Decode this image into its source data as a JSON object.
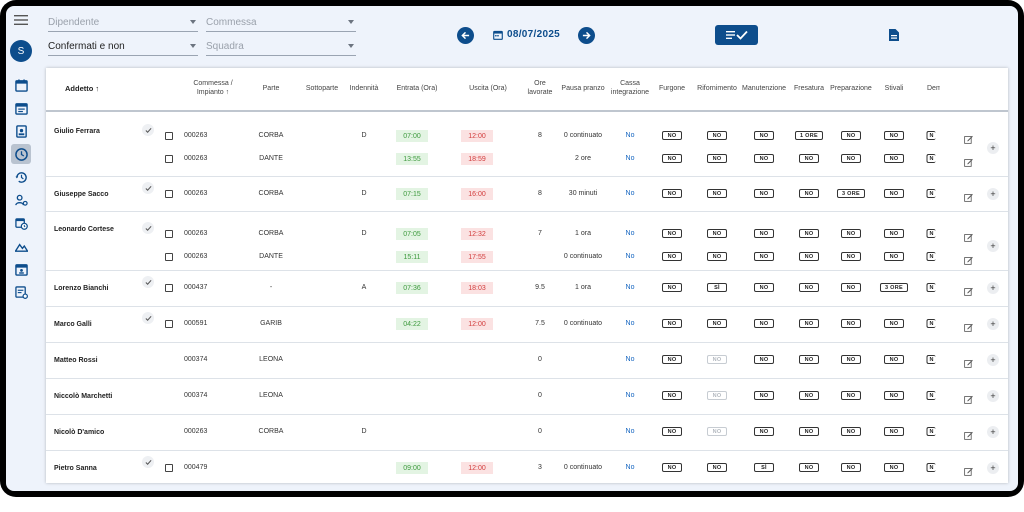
{
  "avatar_initial": "S",
  "filters": {
    "dipendente_placeholder": "Dipendente",
    "commessa_placeholder": "Commessa",
    "stato_value": "Confermati e non",
    "squadra_placeholder": "Squadra"
  },
  "date": "08/07/2025",
  "columns": {
    "addetto": "Addetto ↑",
    "commessa_l1": "Commessa /",
    "commessa_l2": "Impianto ↑",
    "parte": "Parte",
    "sottoparte": "Sottoparte",
    "indennita": "Indennità",
    "entrata": "Entrata (Ora)",
    "uscita": "Uscita (Ora)",
    "ore_l1": "Ore",
    "ore_l2": "lavorate",
    "pausa": "Pausa pranzo",
    "cassa_l1": "Cassa",
    "cassa_l2": "integrazione",
    "furgone": "Furgone",
    "rifornimento": "Rifornimento",
    "manutenzione": "Manutenzione",
    "fresatura": "Fresatura",
    "preparazione": "Preparazione",
    "stivali": "Stivali",
    "demo": "Demo"
  },
  "rows": [
    {
      "name": "Giulio Ferrara",
      "confirmed": true,
      "lines": [
        {
          "commessa": "000263",
          "parte": "CORBA",
          "indennita": "D",
          "entrata": "07:00",
          "uscita": "12:00",
          "ore": "8",
          "pausa": "0 continuato",
          "cassa": "No",
          "furgone": "NO",
          "rifornimento": "NO",
          "manutenzione": "NO",
          "fresatura": "1 ORE",
          "preparazione": "NO",
          "stivali": "NO",
          "demo": "N"
        },
        {
          "commessa": "000263",
          "parte": "DANTE",
          "indennita": "",
          "entrata": "13:55",
          "uscita": "18:59",
          "ore": "",
          "pausa": "2 ore",
          "cassa": "No",
          "furgone": "NO",
          "rifornimento": "NO",
          "manutenzione": "NO",
          "fresatura": "NO",
          "preparazione": "NO",
          "stivali": "NO",
          "demo": "N"
        }
      ]
    },
    {
      "name": "Giuseppe Sacco",
      "confirmed": true,
      "lines": [
        {
          "commessa": "000263",
          "parte": "CORBA",
          "indennita": "D",
          "entrata": "07:15",
          "uscita": "16:00",
          "ore": "8",
          "pausa": "30 minuti",
          "cassa": "No",
          "furgone": "NO",
          "rifornimento": "NO",
          "manutenzione": "NO",
          "fresatura": "NO",
          "preparazione": "3 ORE",
          "stivali": "NO",
          "demo": "N"
        }
      ]
    },
    {
      "name": "Leonardo Cortese",
      "confirmed": true,
      "lines": [
        {
          "commessa": "000263",
          "parte": "CORBA",
          "indennita": "D",
          "entrata": "07:05",
          "uscita": "12:32",
          "ore": "7",
          "pausa": "1 ora",
          "cassa": "No",
          "furgone": "NO",
          "rifornimento": "NO",
          "manutenzione": "NO",
          "fresatura": "NO",
          "preparazione": "NO",
          "stivali": "NO",
          "demo": "N"
        },
        {
          "commessa": "000263",
          "parte": "DANTE",
          "indennita": "",
          "entrata": "15:11",
          "uscita": "17:55",
          "ore": "",
          "pausa": "0 continuato",
          "cassa": "No",
          "furgone": "NO",
          "rifornimento": "NO",
          "manutenzione": "NO",
          "fresatura": "NO",
          "preparazione": "NO",
          "stivali": "NO",
          "demo": "N"
        }
      ]
    },
    {
      "name": "Lorenzo Bianchi",
      "confirmed": true,
      "lines": [
        {
          "commessa": "000437",
          "parte": "-",
          "indennita": "A",
          "entrata": "07:36",
          "uscita": "18:03",
          "ore": "9.5",
          "pausa": "1 ora",
          "cassa": "No",
          "furgone": "NO",
          "rifornimento": "SÌ",
          "manutenzione": "NO",
          "fresatura": "NO",
          "preparazione": "NO",
          "stivali": "3 ORE",
          "demo": "N"
        }
      ]
    },
    {
      "name": "Marco Galli",
      "confirmed": true,
      "lines": [
        {
          "commessa": "000591",
          "parte": "GARIB",
          "indennita": "",
          "entrata": "04:22",
          "uscita": "12:00",
          "ore": "7.5",
          "pausa": "0 continuato",
          "cassa": "No",
          "furgone": "NO",
          "rifornimento": "NO",
          "manutenzione": "NO",
          "fresatura": "NO",
          "preparazione": "NO",
          "stivali": "NO",
          "demo": "N"
        }
      ]
    },
    {
      "name": "Matteo Rossi",
      "confirmed": false,
      "lines": [
        {
          "commessa": "000374",
          "parte": "LEONA",
          "indennita": "",
          "entrata": "",
          "uscita": "",
          "ore": "0",
          "pausa": "",
          "cassa": "No",
          "furgone": "NO",
          "rifornimento": "NO",
          "rifornimento_disabled": true,
          "manutenzione": "NO",
          "fresatura": "NO",
          "preparazione": "NO",
          "stivali": "NO",
          "demo": "N"
        }
      ]
    },
    {
      "name": "Niccolò Marchetti",
      "confirmed": false,
      "lines": [
        {
          "commessa": "000374",
          "parte": "LEONA",
          "indennita": "",
          "entrata": "",
          "uscita": "",
          "ore": "0",
          "pausa": "",
          "cassa": "No",
          "furgone": "NO",
          "rifornimento": "NO",
          "rifornimento_disabled": true,
          "manutenzione": "NO",
          "fresatura": "NO",
          "preparazione": "NO",
          "stivali": "NO",
          "demo": "N"
        }
      ]
    },
    {
      "name": "Nicolò D'amico",
      "confirmed": false,
      "lines": [
        {
          "commessa": "000263",
          "parte": "CORBA",
          "indennita": "D",
          "entrata": "",
          "uscita": "",
          "ore": "0",
          "pausa": "",
          "cassa": "No",
          "furgone": "NO",
          "rifornimento": "NO",
          "rifornimento_disabled": true,
          "manutenzione": "NO",
          "fresatura": "NO",
          "preparazione": "NO",
          "stivali": "NO",
          "demo": "N"
        }
      ]
    },
    {
      "name": "Pietro Sanna",
      "confirmed": true,
      "lines": [
        {
          "commessa": "000479",
          "parte": "",
          "indennita": "",
          "entrata": "09:00",
          "uscita": "12:00",
          "ore": "3",
          "pausa": "0 continuato",
          "cassa": "No",
          "furgone": "NO",
          "rifornimento": "NO",
          "manutenzione": "SÌ",
          "fresatura": "NO",
          "preparazione": "NO",
          "stivali": "NO",
          "demo": "N"
        }
      ]
    }
  ]
}
